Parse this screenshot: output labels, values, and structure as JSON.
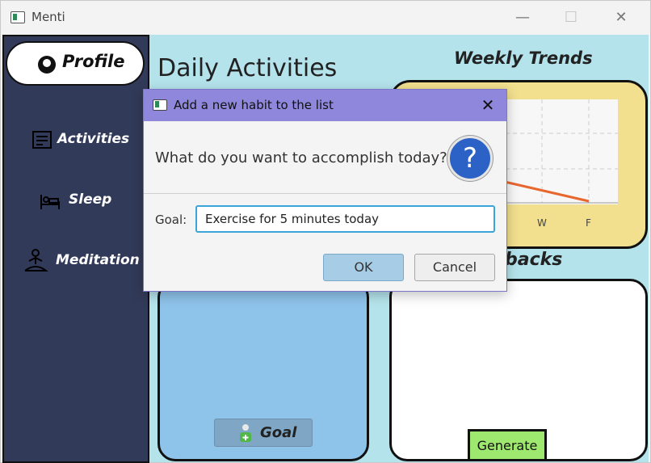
{
  "window": {
    "title": "Menti",
    "controls": {
      "minimize": "—",
      "maximize": "☐",
      "close": "✕"
    }
  },
  "sidebar": {
    "profile_label": "Profile",
    "items": [
      {
        "label": "Activities",
        "icon": "activities-icon"
      },
      {
        "label": "Sleep",
        "icon": "sleep-icon"
      },
      {
        "label": "Meditation",
        "icon": "meditation-icon"
      }
    ]
  },
  "main": {
    "heading": "Daily Activities",
    "weekly_trends_title": "Weekly Trends",
    "trend_axis_ticks": [
      "W",
      "F"
    ],
    "feedback_title_visible": "backs",
    "generate_label": "Generate",
    "goal_button_label": "Goal"
  },
  "dialog": {
    "title": "Add a new habit to the list",
    "question": "What do you want to accomplish today?",
    "goal_label": "Goal:",
    "goal_value": "Exercise for 5 minutes today",
    "ok_label": "OK",
    "cancel_label": "Cancel",
    "close_glyph": "✕",
    "help_glyph": "?"
  },
  "colors": {
    "sidebar_bg": "#323a59",
    "content_bg": "#b5e3ec",
    "trend_panel": "#f2e08e",
    "habit_panel": "#8ec3ea",
    "generate_btn": "#9fe870",
    "dialog_titlebar": "#8e87db",
    "trend_line": "#e8672e",
    "help_icon": "#2c62c6"
  }
}
